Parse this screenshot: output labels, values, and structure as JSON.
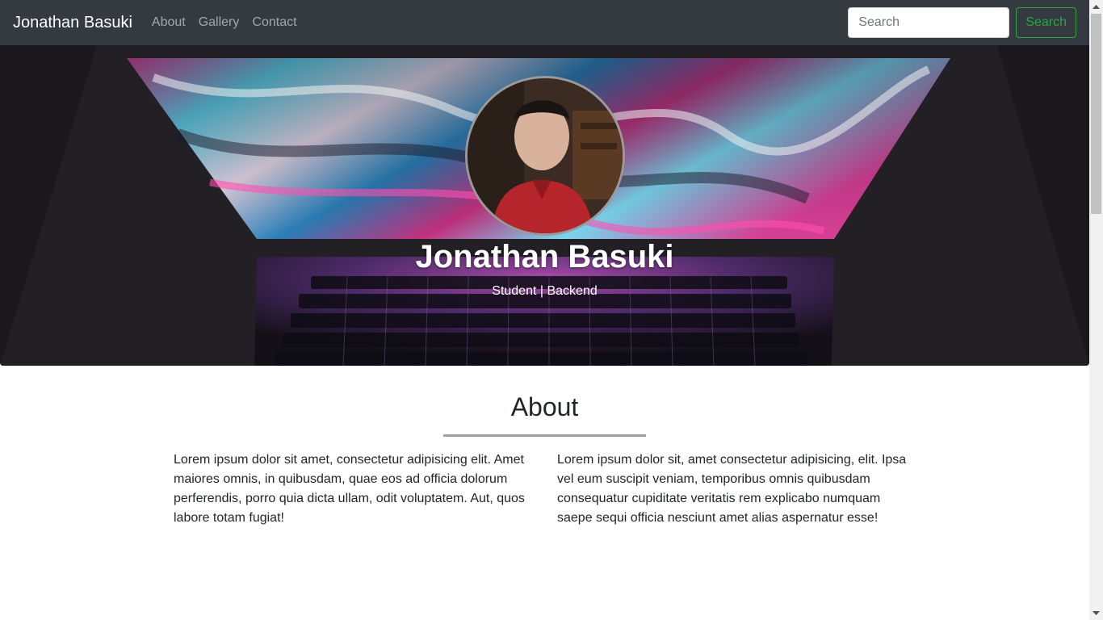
{
  "navbar": {
    "brand": "Jonathan Basuki",
    "links": [
      "About",
      "Gallery",
      "Contact"
    ],
    "search_placeholder": "Search",
    "search_button": "Search"
  },
  "hero": {
    "name": "Jonathan Basuki",
    "subtitle": "Student | Backend"
  },
  "about": {
    "title": "About",
    "paragraphs": [
      "Lorem ipsum dolor sit amet, consectetur adipisicing elit. Amet maiores omnis, in quibusdam, quae eos ad officia dolorum perferendis, porro quia dicta ullam, odit voluptatem. Aut, quos labore totam fugiat!",
      "Lorem ipsum dolor sit, amet consectetur adipisicing, elit. Ipsa vel eum suscipit veniam, temporibus omnis quibusdam consequatur cupiditate veritatis rem explicabo numquam saepe sequi officia nesciunt amet alias aspernatur esse!"
    ]
  },
  "colors": {
    "navbar_bg": "#343a40",
    "search_button": "#28a745",
    "rule": "#a0a0a0"
  },
  "icons": {
    "scroll_up": "triangle-up-icon",
    "scroll_down": "triangle-down-icon"
  }
}
